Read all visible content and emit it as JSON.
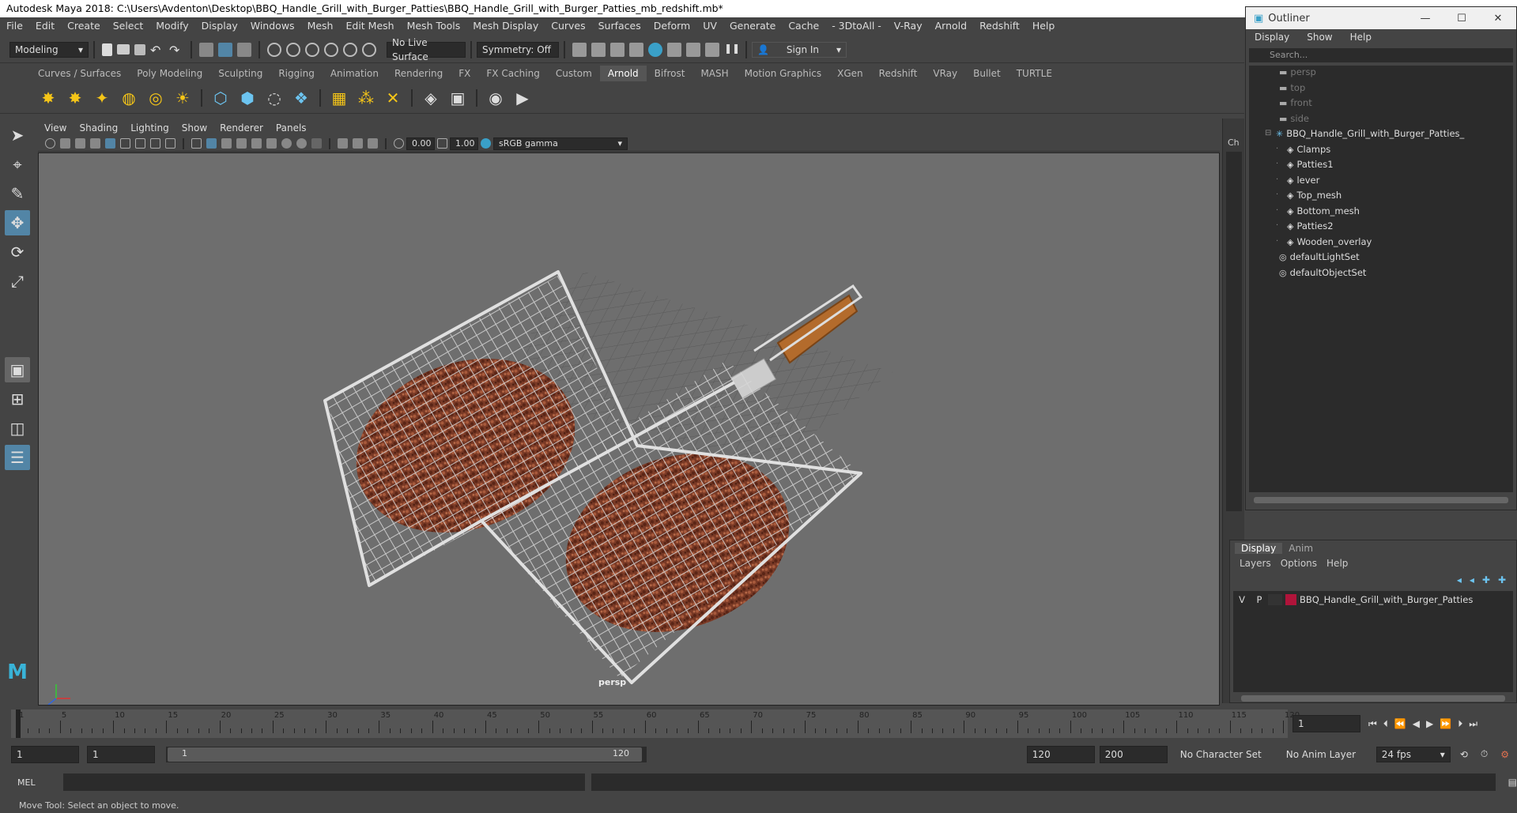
{
  "window": {
    "title": "Autodesk Maya 2018: C:\\Users\\Avdenton\\Desktop\\BBQ_Handle_Grill_with_Burger_Patties\\BBQ_Handle_Grill_with_Burger_Patties_mb_redshift.mb*"
  },
  "menubar": [
    "File",
    "Edit",
    "Create",
    "Select",
    "Modify",
    "Display",
    "Windows",
    "Mesh",
    "Edit Mesh",
    "Mesh Tools",
    "Mesh Display",
    "Curves",
    "Surfaces",
    "Deform",
    "UV",
    "Generate",
    "Cache",
    "- 3DtoAll -",
    "V-Ray",
    "Arnold",
    "Redshift",
    "Help"
  ],
  "statusline": {
    "workspace": "Modeling",
    "live_surface": "No Live Surface",
    "symmetry": "Symmetry: Off",
    "sign_in": "Sign In"
  },
  "shelf_tabs": [
    "Curves / Surfaces",
    "Poly Modeling",
    "Sculpting",
    "Rigging",
    "Animation",
    "Rendering",
    "FX",
    "FX Caching",
    "Custom",
    "Arnold",
    "Bifrost",
    "MASH",
    "Motion Graphics",
    "XGen",
    "Redshift",
    "VRay",
    "Bullet",
    "TURTLE"
  ],
  "shelf_active": "Arnold",
  "viewport": {
    "menu": [
      "View",
      "Shading",
      "Lighting",
      "Show",
      "Renderer",
      "Panels"
    ],
    "exposure": "0.00",
    "gamma": "1.00",
    "color_space": "sRGB gamma",
    "camera_label": "persp"
  },
  "outliner": {
    "title": "Outliner",
    "menu": [
      "Display",
      "Show",
      "Help"
    ],
    "search_placeholder": "Search...",
    "items": [
      {
        "label": "persp",
        "type": "camera",
        "dim": true
      },
      {
        "label": "top",
        "type": "camera",
        "dim": true
      },
      {
        "label": "front",
        "type": "camera",
        "dim": true
      },
      {
        "label": "side",
        "type": "camera",
        "dim": true
      },
      {
        "label": "BBQ_Handle_Grill_with_Burger_Patties_",
        "type": "group",
        "dim": false
      },
      {
        "label": "Clamps",
        "type": "mesh",
        "dim": false
      },
      {
        "label": "Patties1",
        "type": "mesh",
        "dim": false
      },
      {
        "label": "lever",
        "type": "mesh",
        "dim": false
      },
      {
        "label": "Top_mesh",
        "type": "mesh",
        "dim": false
      },
      {
        "label": "Bottom_mesh",
        "type": "mesh",
        "dim": false
      },
      {
        "label": "Patties2",
        "type": "mesh",
        "dim": false
      },
      {
        "label": "Wooden_overlay",
        "type": "mesh",
        "dim": false
      },
      {
        "label": "defaultLightSet",
        "type": "set",
        "dim": false
      },
      {
        "label": "defaultObjectSet",
        "type": "set",
        "dim": false
      }
    ]
  },
  "channel_tab": "Ch",
  "layer_editor": {
    "tabs": [
      "Display",
      "Anim"
    ],
    "menu": [
      "Layers",
      "Options",
      "Help"
    ],
    "layer": {
      "v": "V",
      "p": "P",
      "name": "BBQ_Handle_Grill_with_Burger_Patties",
      "color": "#b0143a"
    }
  },
  "timeline": {
    "ticks": [
      "1",
      "5",
      "10",
      "15",
      "20",
      "25",
      "30",
      "35",
      "40",
      "45",
      "50",
      "55",
      "60",
      "65",
      "70",
      "75",
      "80",
      "85",
      "90",
      "95",
      "100",
      "105",
      "110",
      "115",
      "120"
    ],
    "current_frame": "1"
  },
  "range": {
    "start": "1",
    "current": "1",
    "slider_start": "1",
    "slider_end": "120",
    "end": "120",
    "max": "200",
    "character_set": "No Character Set",
    "anim_layer": "No Anim Layer",
    "fps": "24 fps"
  },
  "cmdline": {
    "label": "MEL"
  },
  "helpline": "Move Tool: Select an object to move."
}
